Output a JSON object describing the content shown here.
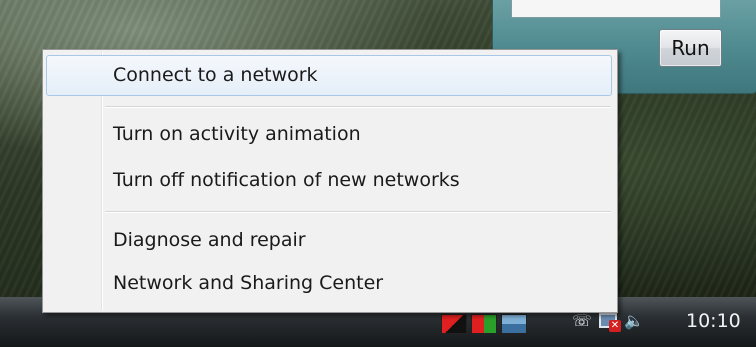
{
  "run_dialog": {
    "run_label": "Run"
  },
  "context_menu": {
    "items": [
      {
        "label": "Connect to a network",
        "highlighted": true
      },
      {
        "label": "Turn on activity animation"
      },
      {
        "label": "Turn off notification of new networks"
      },
      {
        "label": "Diagnose and repair"
      },
      {
        "label": "Network and Sharing Center"
      }
    ]
  },
  "taskbar": {
    "clock": "10:10",
    "tray_icons": [
      "phone-icon",
      "network-disconnected-icon",
      "speaker-volume-icon"
    ],
    "tray_app_icons": [
      "app-icon-red-black",
      "app-icon-red-green",
      "app-icon-blue"
    ]
  },
  "colors": {
    "menu_background": "#f1f1f1",
    "menu_highlight_border": "#a9c8e8",
    "taskbar": "#1f2326",
    "network_error": "#d42020"
  }
}
